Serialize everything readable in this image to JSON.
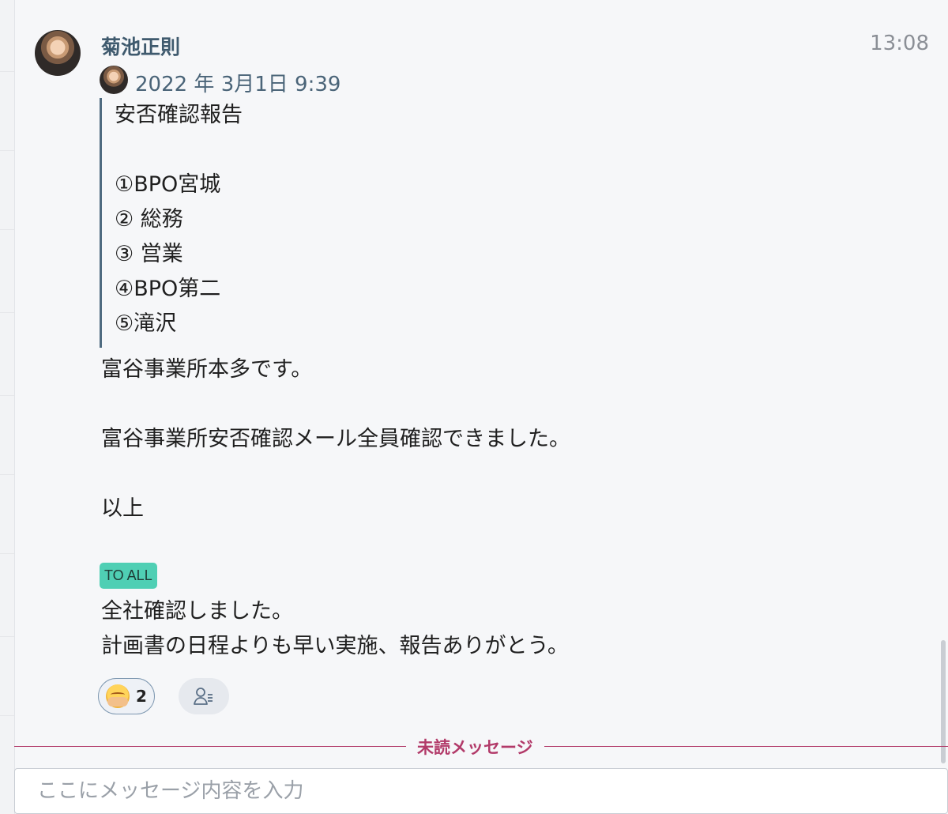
{
  "message": {
    "sender": "菊池正則",
    "time": "13:08",
    "quote": {
      "date": "2022 年 3月1日 9:39",
      "lines": [
        "安否確認報告",
        "",
        "①BPO宮城",
        "② 総務",
        "③ 営業",
        "④BPO第二",
        "⑤滝沢"
      ]
    },
    "body_lines": [
      "富谷事業所本多です。",
      "",
      "富谷事業所安否確認メール全員確認できました。",
      "",
      "以上",
      ""
    ],
    "tag": "TO ALL",
    "reply_lines": [
      "全社確認しました。",
      "計画書の日程よりも早い実施、報告ありがとう。"
    ],
    "reactions": [
      {
        "icon": "face-emoji-icon",
        "count": "2"
      }
    ]
  },
  "divider": {
    "label": "未読メッセージ"
  },
  "composer": {
    "placeholder": "ここにメッセージ内容を入力"
  },
  "colors": {
    "sender": "#3f5a6e",
    "tag": "#4fcfb4",
    "unread": "#b23a69"
  }
}
